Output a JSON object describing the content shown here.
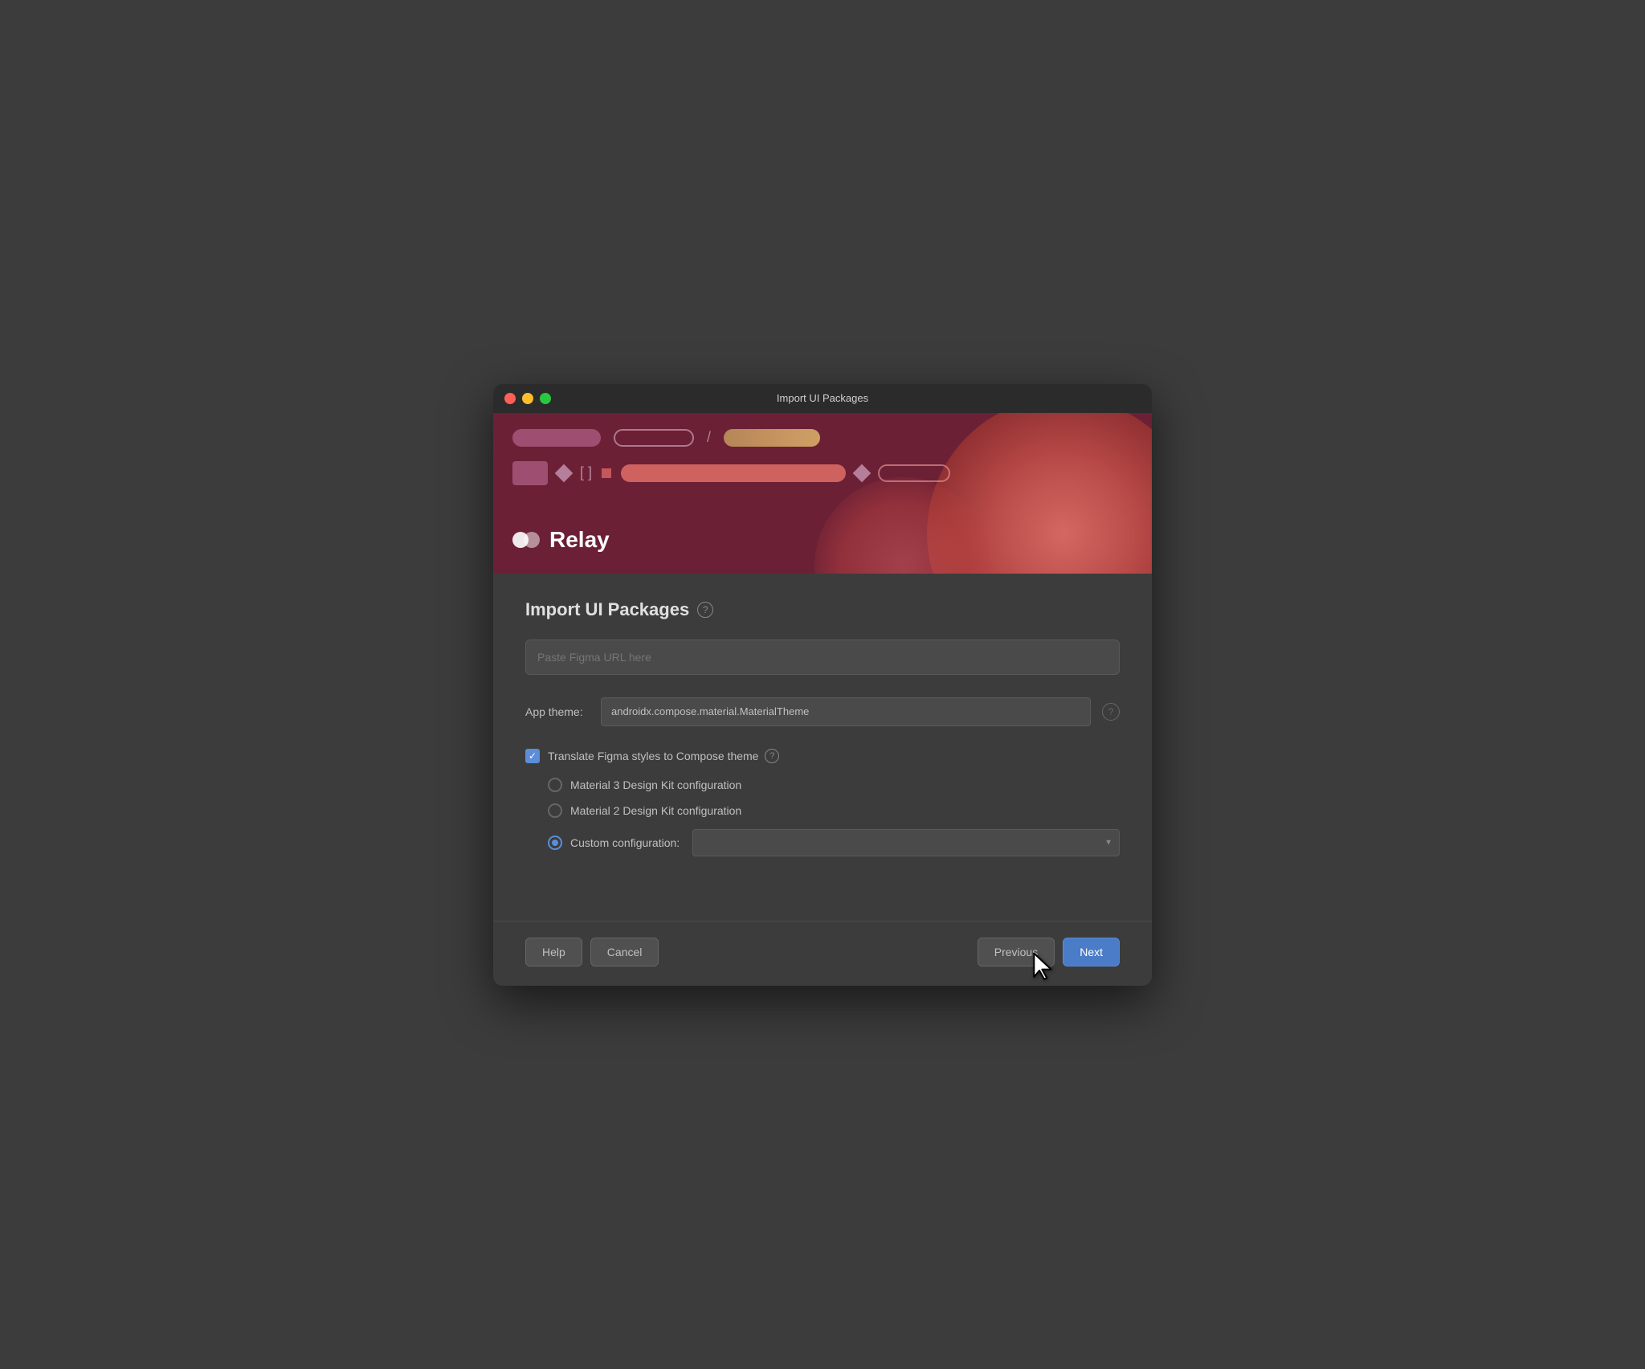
{
  "window": {
    "title": "Import UI Packages"
  },
  "banner": {
    "relay_text": "Relay"
  },
  "content": {
    "page_title": "Import UI Packages",
    "help_icon": "?",
    "figma_url_placeholder": "Paste Figma URL here",
    "app_theme_label": "App theme:",
    "app_theme_value": "androidx.compose.material.MaterialTheme",
    "translate_checkbox_label": "Translate Figma styles to Compose theme",
    "translate_checked": true,
    "radio_options": [
      {
        "id": "material3",
        "label": "Material 3 Design Kit configuration",
        "selected": false
      },
      {
        "id": "material2",
        "label": "Material 2 Design Kit configuration",
        "selected": false
      },
      {
        "id": "custom",
        "label": "Custom configuration:",
        "selected": true
      }
    ]
  },
  "footer": {
    "help_label": "Help",
    "cancel_label": "Cancel",
    "previous_label": "Previous",
    "next_label": "Next"
  }
}
